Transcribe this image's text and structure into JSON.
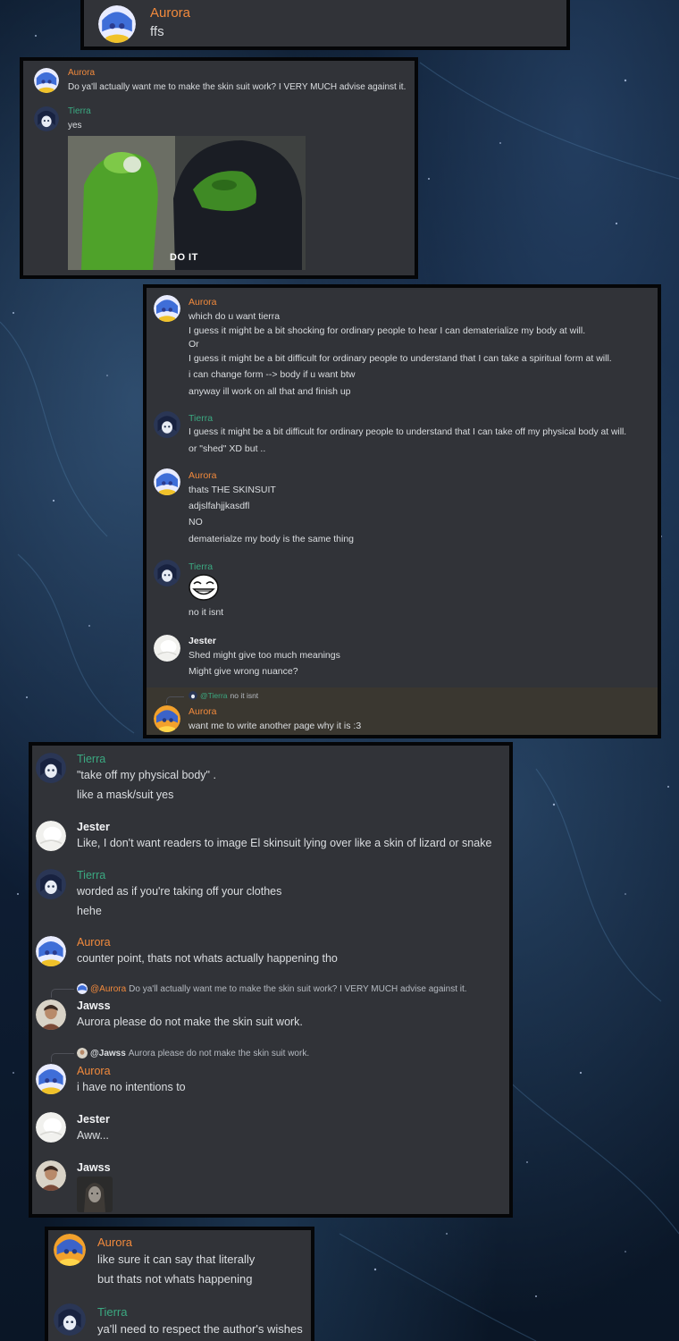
{
  "colors": {
    "aurora_name": "#f28a3c",
    "tierra_name": "#3ba981",
    "plain_name": "#f2f3f5",
    "message_text": "#dbdee1",
    "panel_bg": "#313338",
    "highlight_bg": "#3a3730"
  },
  "icons": {
    "aurora_avatar": "anime-avatar-icon",
    "tierra_avatar": "dark-avatar-icon",
    "jester_avatar": "white-avatar-icon",
    "jawss_avatar": "portrait-avatar-icon"
  },
  "panel1": {
    "m1": {
      "author": "Aurora",
      "lines": [
        "ffs"
      ]
    }
  },
  "panel2": {
    "m1": {
      "author": "Aurora",
      "lines": [
        "Do ya'll actually want me to make the skin suit work?  I VERY MUCH advise against it."
      ]
    },
    "m2": {
      "author": "Tierra",
      "lines": [
        "yes"
      ],
      "image_caption": "DO IT"
    }
  },
  "panel3": {
    "m1": {
      "author": "Aurora",
      "lines": [
        "which do u want tierra",
        "I guess it might be a bit shocking for ordinary people to hear I can dematerialize my body at will.",
        "Or",
        "I guess it might be a bit difficult for ordinary people to understand that I can take a spiritual form at will.",
        "i can change form --> body if u want btw",
        "anyway ill work on all that and finish up"
      ]
    },
    "m2": {
      "author": "Tierra",
      "lines": [
        "I guess it might be a bit difficult for ordinary people to understand that I can take off my physical body at will.",
        "or \"shed\" XD but .."
      ]
    },
    "m3": {
      "author": "Aurora",
      "lines": [
        "thats THE SKINSUIT",
        "adjslfahjjkasdfl",
        "NO",
        "dematerialze my body is the same thing"
      ]
    },
    "m4": {
      "author": "Tierra",
      "lines": [
        "no it isnt"
      ]
    },
    "m5": {
      "author": "Jester",
      "lines": [
        "Shed might give too much meanings",
        "Might give wrong nuance?"
      ]
    },
    "m6": {
      "reply_mention": "@Tierra",
      "reply_text": "no it isnt",
      "author": "Aurora",
      "lines": [
        "want me to write another page why it is :3"
      ]
    }
  },
  "panel4": {
    "m1": {
      "author": "Tierra",
      "lines": [
        "\"take off my physical body\" .",
        "like a mask/suit yes"
      ]
    },
    "m2": {
      "author": "Jester",
      "lines": [
        "Like, I don't want readers to image El skinsuit lying over like a skin of lizard or snake"
      ]
    },
    "m3": {
      "author": "Tierra",
      "lines": [
        "worded as if you're taking off your clothes",
        "hehe"
      ]
    },
    "m4": {
      "author": "Aurora",
      "lines": [
        "counter point, thats not whats actually happening tho"
      ]
    },
    "m5": {
      "reply_mention": "@Aurora",
      "reply_text": "Do ya'll actually want me to make the skin suit work?  I VERY MUCH advise against it.",
      "author": "Jawss",
      "lines": [
        "Aurora please do not make the skin suit work."
      ]
    },
    "m6": {
      "reply_mention": "@Jawss",
      "reply_text": "Aurora please do not make the skin suit work.",
      "author": "Aurora",
      "lines": [
        "i have no intentions to"
      ]
    },
    "m7": {
      "author": "Jester",
      "lines": [
        "Aww..."
      ]
    },
    "m8": {
      "author": "Jawss"
    }
  },
  "panel5": {
    "m1": {
      "author": "Aurora",
      "lines": [
        "like sure it can say that literally",
        "but thats not whats happening"
      ]
    },
    "m2": {
      "author": "Tierra",
      "lines": [
        "ya'll need to respect the author's wishes"
      ]
    }
  }
}
